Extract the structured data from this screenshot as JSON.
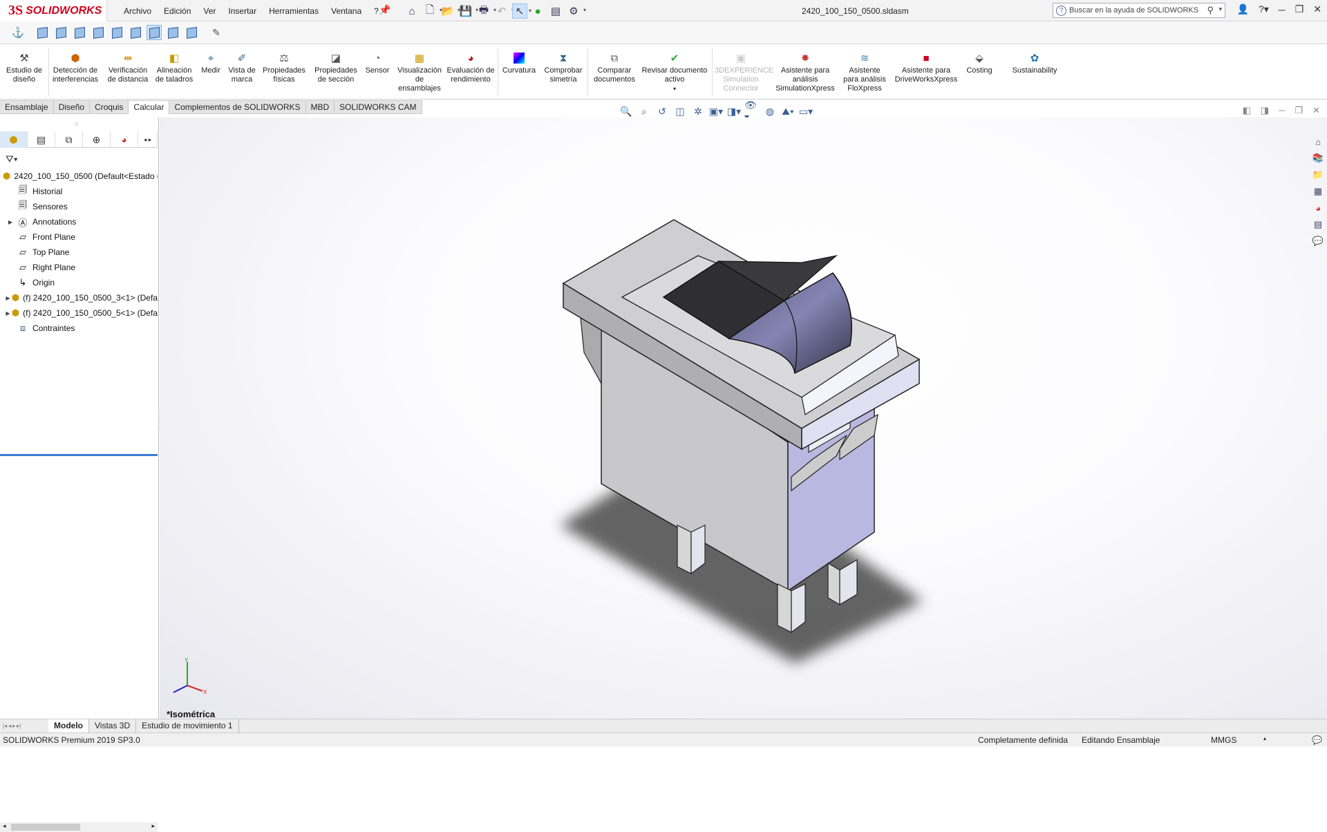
{
  "app": {
    "brand_ds": "3S",
    "brand_name": "SOLIDWORKS",
    "doc_title": "2420_100_150_0500.sldasm"
  },
  "menu": [
    "Archivo",
    "Edición",
    "Ver",
    "Insertar",
    "Herramientas",
    "Ventana",
    "?"
  ],
  "search": {
    "placeholder": "Buscar en la ayuda de SOLIDWORKS"
  },
  "ribbon": {
    "items": [
      {
        "label": "Estudio de diseño",
        "icon": "design-study-icon"
      },
      {
        "label": "Detección de interferencias",
        "icon": "interference-icon"
      },
      {
        "label": "Verificación de distancia",
        "icon": "clearance-icon"
      },
      {
        "label": "Alineación de taladros",
        "icon": "hole-align-icon"
      },
      {
        "label": "Medir",
        "icon": "measure-icon"
      },
      {
        "label": "Vista de marca",
        "icon": "markup-icon"
      },
      {
        "label": "Propiedades físicas",
        "icon": "mass-props-icon"
      },
      {
        "label": "Propiedades de sección",
        "icon": "section-props-icon"
      },
      {
        "label": "Sensor",
        "icon": "sensor-icon"
      },
      {
        "label": "Visualización de ensamblajes",
        "icon": "assembly-vis-icon"
      },
      {
        "label": "Evaluación de rendimiento",
        "icon": "performance-icon"
      },
      {
        "label": "Curvatura",
        "icon": "curvature-icon"
      },
      {
        "label": "Comprobar simetría",
        "icon": "symmetry-icon"
      },
      {
        "label": "Comparar documentos",
        "icon": "compare-icon"
      },
      {
        "label": "Revisar documento activo",
        "icon": "check-doc-icon"
      },
      {
        "label": "3DEXPERIENCE Simulation Connector",
        "icon": "simulation-connector-icon"
      },
      {
        "label": "Asistente para análisis SimulationXpress",
        "icon": "simxpress-icon"
      },
      {
        "label": "Asistente para análisis FloXpress",
        "icon": "floxpress-icon"
      },
      {
        "label": "Asistente para DriveWorksXpress",
        "icon": "driveworks-icon"
      },
      {
        "label": "Costing",
        "icon": "costing-icon"
      },
      {
        "label": "Sustainability",
        "icon": "sustainability-icon"
      }
    ]
  },
  "tabs": [
    "Ensamblaje",
    "Diseño",
    "Croquis",
    "Calcular",
    "Complementos de SOLIDWORKS",
    "MBD",
    "SOLIDWORKS CAM"
  ],
  "active_tab": "Calcular",
  "tree": {
    "root": "2420_100_150_0500  (Default<Estado d",
    "items": [
      {
        "label": "Historial",
        "icon": "history-icon",
        "expand": ""
      },
      {
        "label": "Sensores",
        "icon": "sensor-folder-icon",
        "expand": ""
      },
      {
        "label": "Annotations",
        "icon": "annotations-icon",
        "expand": "▶"
      },
      {
        "label": "Front Plane",
        "icon": "plane-icon",
        "expand": ""
      },
      {
        "label": "Top Plane",
        "icon": "plane-icon",
        "expand": ""
      },
      {
        "label": "Right Plane",
        "icon": "plane-icon",
        "expand": ""
      },
      {
        "label": "Origin",
        "icon": "origin-icon",
        "expand": ""
      },
      {
        "label": "(f) 2420_100_150_0500_3<1> (Defa",
        "icon": "subassembly-icon",
        "expand": "▶"
      },
      {
        "label": "(f) 2420_100_150_0500_5<1> (Defa",
        "icon": "subassembly-icon",
        "expand": "▶"
      },
      {
        "label": "Contraintes",
        "icon": "mates-icon",
        "expand": ""
      }
    ]
  },
  "viewport": {
    "view_name": "*Isométrica"
  },
  "bottom_tabs": [
    "Modelo",
    "Vistas 3D",
    "Estudio de movimiento 1"
  ],
  "status": {
    "product": "SOLIDWORKS Premium 2019 SP3.0",
    "definition": "Completamente definida",
    "mode": "Editando Ensamblaje",
    "units": "MMGS"
  },
  "colors": {
    "brand": "#d0021b",
    "accent": "#3b7bd6"
  }
}
